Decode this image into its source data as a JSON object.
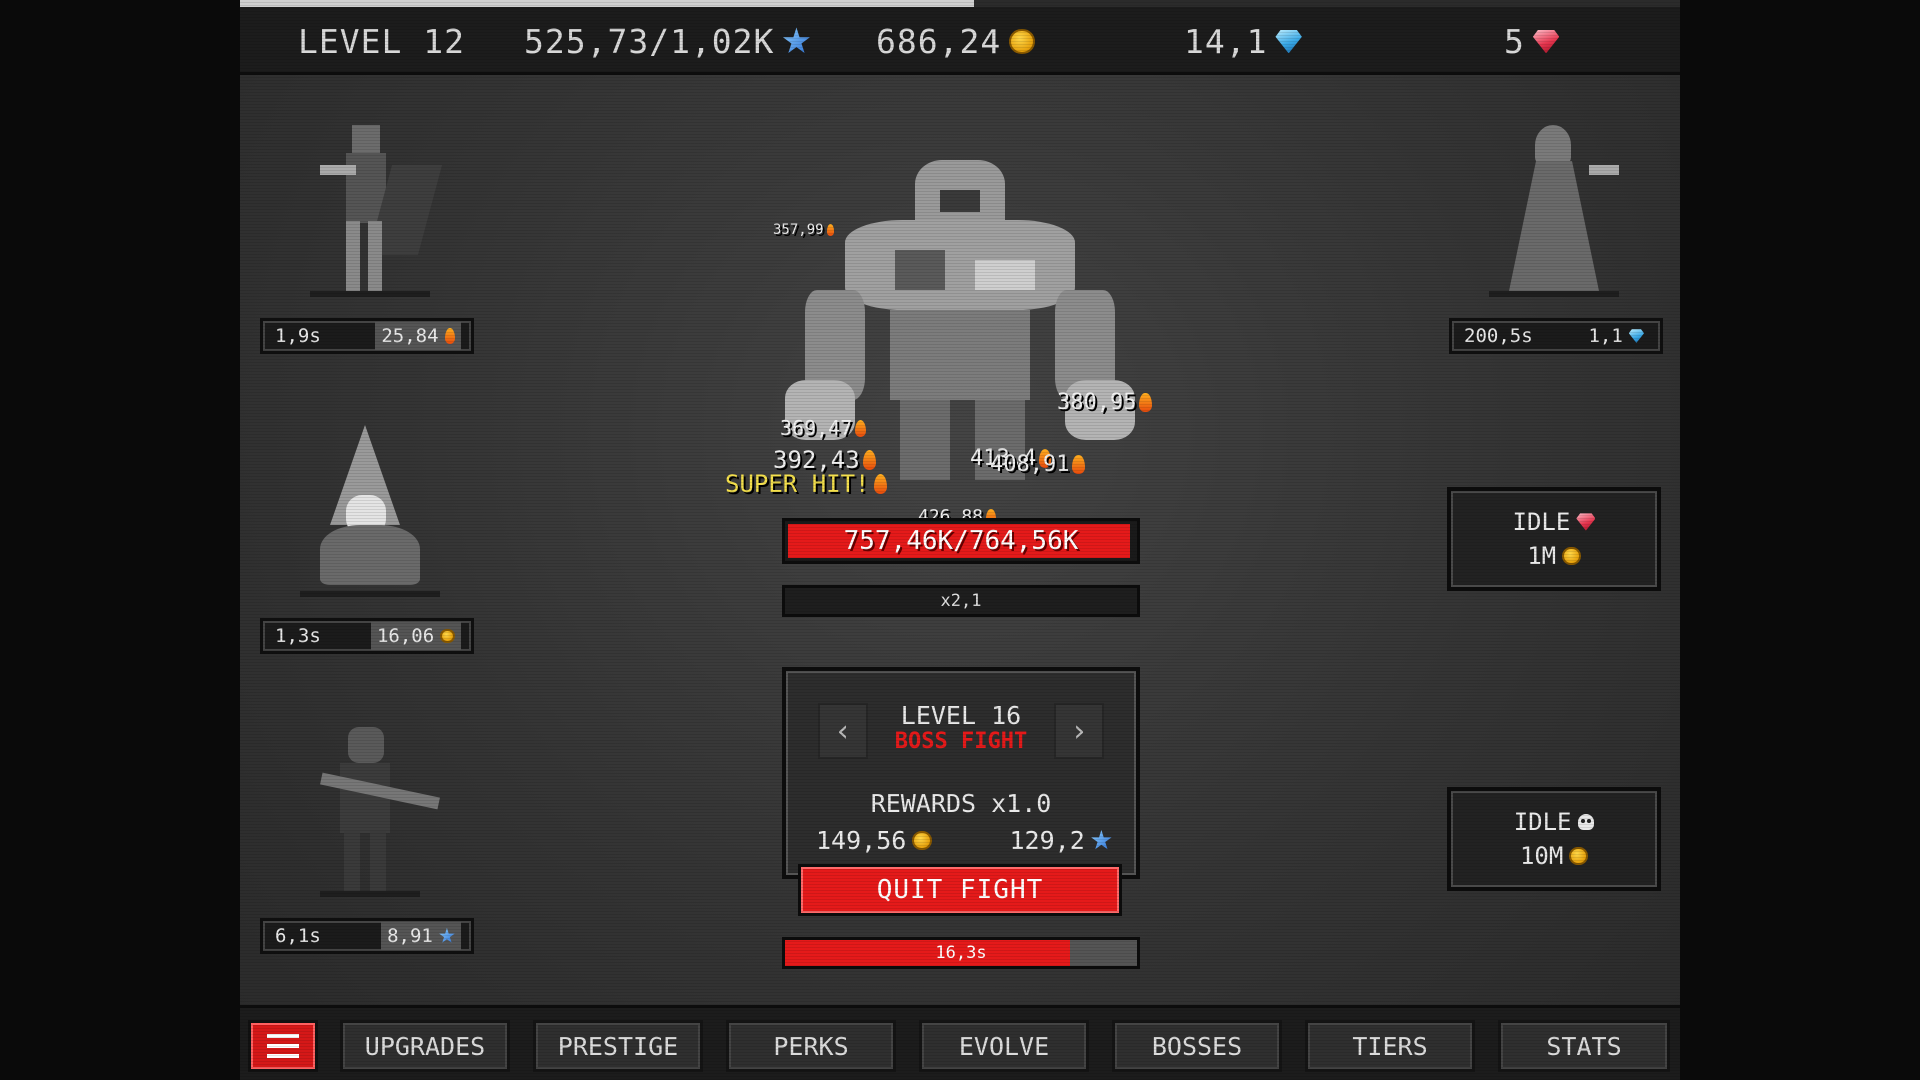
{
  "top_bar": {
    "level": "LEVEL 12",
    "xp": "525,73/1,02K",
    "xp_progress": 0.51,
    "coins": "686,24",
    "gems": "14,1",
    "rubies": "5"
  },
  "heroes": [
    {
      "time": "1,9s",
      "value": "25,84",
      "icon": "flame-icon"
    },
    {
      "time": "1,3s",
      "value": "16,06",
      "icon": "coin-icon"
    },
    {
      "time": "6,1s",
      "value": "8,91",
      "icon": "star-icon"
    },
    {
      "time": "200,5s",
      "value": "1,1",
      "icon": "gem-icon"
    }
  ],
  "damage_numbers": [
    "357,99",
    "380,95",
    "369,47",
    "392,43",
    "413,4",
    "408,91",
    "426,88"
  ],
  "super_hit": "SUPER HIT!",
  "boss_hp": {
    "text": "757,46K/764,56K",
    "fraction": 0.99
  },
  "multiplier": "x2,1",
  "level_panel": {
    "title": "LEVEL 16",
    "subtitle": "BOSS FIGHT",
    "prev": "‹",
    "next": "›",
    "rewards_title": "REWARDS x1.0",
    "reward_coins": "149,56",
    "reward_stars": "129,2"
  },
  "quit_button": "QUIT FIGHT",
  "fight_timer": {
    "text": "16,3s",
    "fraction": 0.81
  },
  "idle_boxes": [
    {
      "label": "IDLE",
      "icon": "ruby-icon",
      "cost": "1M"
    },
    {
      "label": "IDLE",
      "icon": "skull-icon",
      "cost": "10M"
    }
  ],
  "bottom_nav": [
    "UPGRADES",
    "PRESTIGE",
    "PERKS",
    "EVOLVE",
    "BOSSES",
    "TIERS",
    "STATS"
  ],
  "colors": {
    "accent_red": "#e51a1a",
    "super_hit": "#f4e04d",
    "coin": "#f0b418",
    "gem": "#39a8e6",
    "ruby": "#e6364f"
  }
}
